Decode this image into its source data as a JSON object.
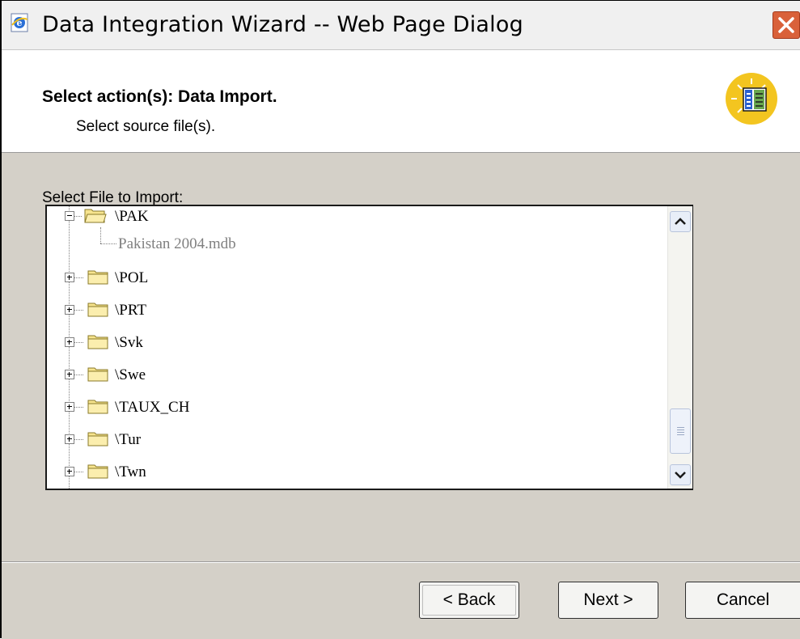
{
  "window": {
    "title": "Data Integration Wizard -- Web Page Dialog"
  },
  "header": {
    "title": "Select action(s): Data Import.",
    "subtitle": "Select source file(s)."
  },
  "body": {
    "file_label": "Select File to Import:"
  },
  "tree": {
    "items": [
      {
        "label": "\\PAK",
        "expanded": true
      },
      {
        "label": "Pakistan 2004.mdb",
        "is_file": true
      },
      {
        "label": "\\POL"
      },
      {
        "label": "\\PRT"
      },
      {
        "label": "\\Svk"
      },
      {
        "label": "\\Swe"
      },
      {
        "label": "\\TAUX_CH"
      },
      {
        "label": "\\Tur"
      },
      {
        "label": "\\Twn"
      }
    ]
  },
  "buttons": {
    "back_label": "< Back",
    "next_label": "Next >",
    "cancel_label": "Cancel"
  },
  "colors": {
    "title_close": "#d9613a",
    "folder_fill": "#f7e48e",
    "dialog_bg": "#d4d0c8",
    "wizard_icon_bg": "#f3c520"
  }
}
